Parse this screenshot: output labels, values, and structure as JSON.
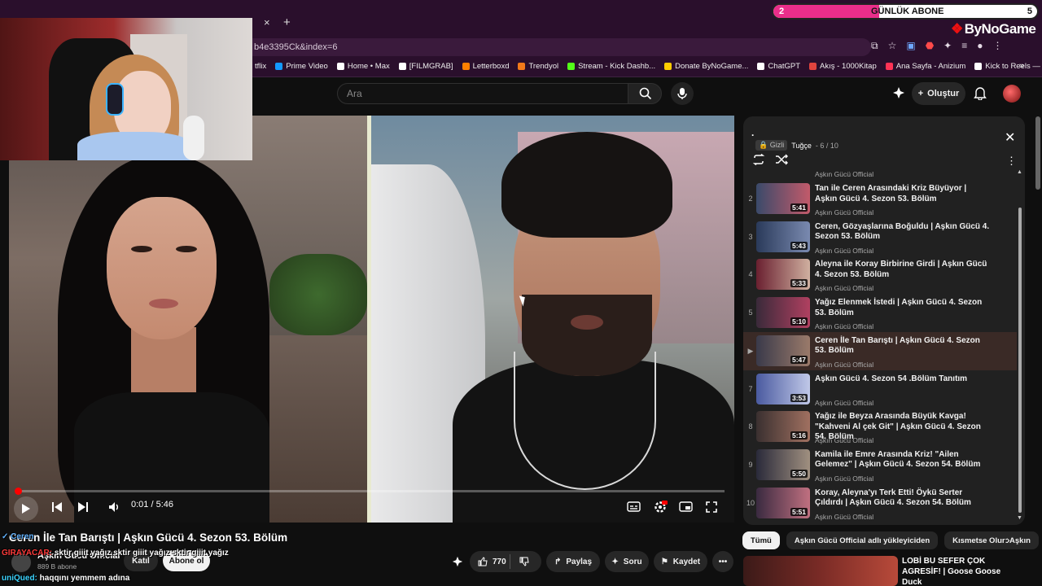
{
  "subscriber_overlay": {
    "left_value": "2",
    "title": "GÜNLÜK ABONE",
    "right_value": "5",
    "fill_fraction": 0.4,
    "brand": "ByNoGame"
  },
  "browser": {
    "tab_close": "×",
    "new_tab": "+",
    "url": "b4e3395Ck&index=6",
    "bookmarks": [
      {
        "label": "tflix",
        "color": "#e50914"
      },
      {
        "label": "Prime Video",
        "color": "#1399ff"
      },
      {
        "label": "Home • Max",
        "color": "#ffffff"
      },
      {
        "label": "[FILMGRAB]",
        "color": "#ffffff"
      },
      {
        "label": "Letterboxd",
        "color": "#ff8000"
      },
      {
        "label": "Trendyol",
        "color": "#f27a1a"
      },
      {
        "label": "Stream - Kick Dashb...",
        "color": "#53fc18"
      },
      {
        "label": "Donate ByNoGame...",
        "color": "#ffcc00"
      },
      {
        "label": "ChatGPT",
        "color": "#ffffff"
      },
      {
        "label": "Akış - 1000Kitap",
        "color": "#e0443e"
      },
      {
        "label": "Ana Sayfa - Anizium",
        "color": "#ff3355"
      },
      {
        "label": "Kick to Reels — by...",
        "color": "#ffffff"
      }
    ],
    "bookmarks_more": "»"
  },
  "header": {
    "search_placeholder": "Ara",
    "create_label": "Oluştur"
  },
  "player": {
    "time": "0:01 / 5:46",
    "progress_fraction": 0.003
  },
  "video": {
    "title": "Ceren İle Tan Barıştı | Aşkın Gücü 4. Sezon 53. Bölüm",
    "channel": "Aşkın Gücü Official",
    "subs": "889 B abone",
    "join_label": "Katıl",
    "subscribe_label": "Abone ol",
    "likes": "770",
    "share_label": "Paylaş",
    "ask_label": "Soru",
    "save_label": "Kaydet"
  },
  "playlist": {
    "title": ".",
    "privacy": "Gizli",
    "owner": "Tuğçe",
    "position": "- 6 / 10",
    "partial_top_channel": "Aşkın Gücü Official",
    "items": [
      {
        "num": "2",
        "title": "Tan ile Ceren Arasındaki Kriz Büyüyor | Aşkın Gücü 4. Sezon 53. Bölüm",
        "channel": "Aşkın Gücü Official",
        "duration": "5:41",
        "c1": "#3a4a6a",
        "c2": "#c25a6a"
      },
      {
        "num": "3",
        "title": "Ceren, Gözyaşlarına Boğuldu | Aşkın Gücü 4. Sezon 53. Bölüm",
        "channel": "Aşkın Gücü Official",
        "duration": "5:43",
        "c1": "#2a3a5a",
        "c2": "#7a8ab0"
      },
      {
        "num": "4",
        "title": "Aleyna ile Koray Birbirine Girdi | Aşkın Gücü 4. Sezon 53. Bölüm",
        "channel": "Aşkın Gücü Official",
        "duration": "5:33",
        "c1": "#6a2030",
        "c2": "#d0b0a0"
      },
      {
        "num": "5",
        "title": "Yağız Elenmek İstedi | Aşkın Gücü 4. Sezon 53. Bölüm",
        "channel": "Aşkın Gücü Official",
        "duration": "5:10",
        "c1": "#3a2a3a",
        "c2": "#b04060"
      },
      {
        "num": "▶",
        "title": "Ceren İle Tan Barıştı | Aşkın Gücü 4. Sezon 53. Bölüm",
        "channel": "Aşkın Gücü Official",
        "duration": "5:47",
        "c1": "#3a3a4a",
        "c2": "#9a7a6a",
        "active": true
      },
      {
        "num": "7",
        "title": "Aşkın Gücü 4. Sezon 54 .Bölüm Tanıtım",
        "channel": "Aşkın Gücü Official",
        "duration": "3:53",
        "c1": "#4a5aa0",
        "c2": "#c0c8e8"
      },
      {
        "num": "8",
        "title": "Yağız ile Beyza Arasında Büyük Kavga! \"Kahveni Al çek Git\" | Aşkın Gücü 4. Sezon 54. Bölüm",
        "channel": "Aşkın Gücü Official",
        "duration": "5:16",
        "c1": "#3a3030",
        "c2": "#a07060"
      },
      {
        "num": "9",
        "title": "Kamila ile Emre Arasında Kriz! \"Ailen Gelemez\" | Aşkın Gücü 4. Sezon 54. Bölüm",
        "channel": "Aşkın Gücü Official",
        "duration": "5:50",
        "c1": "#2a2a3a",
        "c2": "#a09080"
      },
      {
        "num": "10",
        "title": "Koray, Aleyna'yı Terk Etti! Öykü Serter Çıldırdı | Aşkın Gücü 4. Sezon 54. Bölüm",
        "channel": "Aşkın Gücü Official",
        "duration": "5:51",
        "c1": "#3a2a40",
        "c2": "#c07080"
      }
    ]
  },
  "chips": [
    "Tümü",
    "Aşkın Gücü Official adlı yükleyiciden",
    "Kısmetse Olur: Aşkın"
  ],
  "recommendation": {
    "title": "LOBİ BU SEFER ÇOK AGRESİF! | Goose Goose Duck"
  },
  "chat": [
    {
      "user": "✓ Ceren",
      "text": "",
      "cls": "user1"
    },
    {
      "user": "GIRAYACAR:",
      "text": "sktir giiit yağız sktir giiit yağız sktir giiit yağız",
      "cls": "user2"
    },
    {
      "user": "uniQued:",
      "text": "haqqını yemmem adına",
      "cls": "user3"
    }
  ]
}
